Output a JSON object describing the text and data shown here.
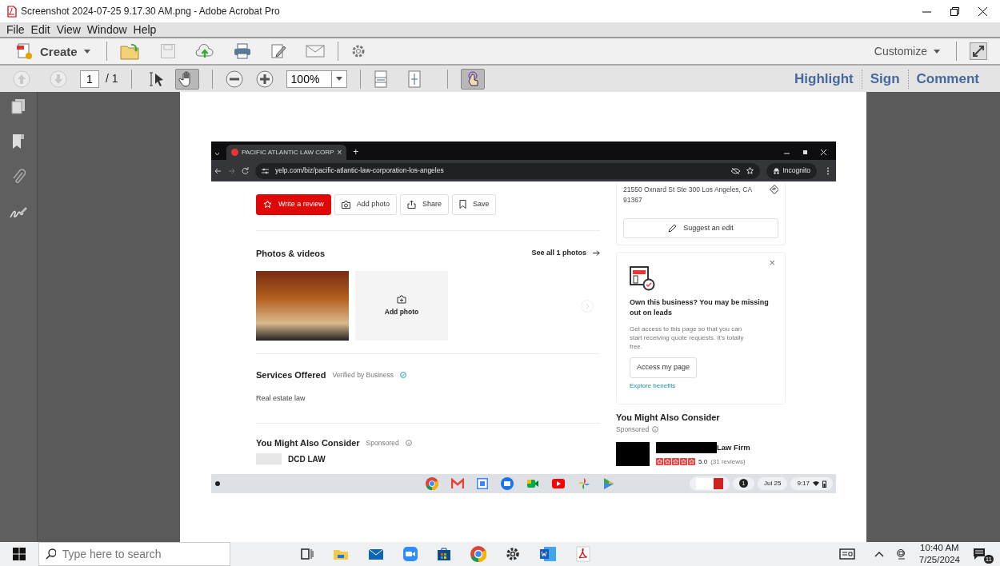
{
  "window": {
    "title": "Screenshot 2024-07-25 9.17.30 AM.png - Adobe Acrobat Pro"
  },
  "menu": [
    "File",
    "Edit",
    "View",
    "Window",
    "Help"
  ],
  "toolbar": {
    "create": "Create",
    "customize": "Customize"
  },
  "nav": {
    "page": "1",
    "total": "/ 1",
    "zoom": "100%",
    "select_tool": {
      "selected": false
    },
    "hand_tool": {
      "selected": true
    },
    "touch_mode": {
      "selected": true
    }
  },
  "task_links": [
    "Highlight",
    "Sign",
    "Comment"
  ],
  "browser": {
    "tab_title": "PACIFIC ATLANTIC LAW CORP",
    "tab_close": "×",
    "new_tab": "+",
    "url": "yelp.com/biz/pacific-atlantic-law-corporation-los-angeles",
    "profile": "Incognito",
    "actions": [
      {
        "label": "Write a review",
        "kind": "primary"
      },
      {
        "label": "Add photo",
        "kind": "outline"
      },
      {
        "label": "Share",
        "kind": "outline"
      },
      {
        "label": "Save",
        "kind": "outline"
      }
    ],
    "photos": {
      "title": "Photos & videos",
      "see_all": "See all 1 photos",
      "add_photo": "Add photo"
    },
    "services": {
      "title": "Services Offered",
      "verified": "Verified by Business",
      "items": [
        "Real estate law"
      ]
    },
    "consider_left": {
      "title": "You Might Also Consider",
      "sponsored": "Sponsored",
      "first": "DCD LAW"
    },
    "location": {
      "address": "21550 Oxnard St Ste 300 Los Angeles, CA 91367",
      "suggest": "Suggest an edit"
    },
    "claim": {
      "title": "Own this business? You may be missing out on leads",
      "body": "Get access to this page so that you can start receiving quote requests. It's totally free.",
      "button": "Access my page",
      "link": "Explore benefits",
      "close": "×"
    },
    "consider_right": {
      "title": "You Might Also Consider",
      "sponsored": "Sponsored",
      "ad": {
        "name": "Law Firm",
        "stars": 5,
        "rating": "5.0",
        "reviews": "(31 reviews)"
      }
    },
    "shelf": {
      "notifications": "1",
      "date": "Jul 25",
      "time": "9:17"
    }
  },
  "taskbar": {
    "search_placeholder": "Type here to search",
    "time": "10:40 AM",
    "date": "7/25/2024",
    "notifications": "11"
  }
}
